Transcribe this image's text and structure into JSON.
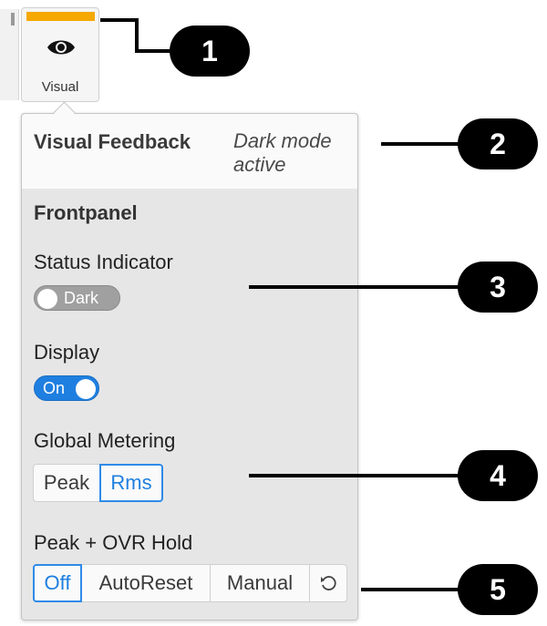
{
  "tabs": {
    "visual_label": "Visual",
    "accent_color": "#f5a800",
    "icon": "eye-icon"
  },
  "popover": {
    "title": "Visual Feedback",
    "subtitle": "Dark mode active",
    "section": "Frontpanel",
    "status_indicator": {
      "label": "Status Indicator",
      "toggle_label": "Dark",
      "state": "off"
    },
    "display": {
      "label": "Display",
      "toggle_label": "On",
      "state": "on"
    },
    "global_metering": {
      "label": "Global Metering",
      "options": [
        "Peak",
        "Rms"
      ],
      "selected": "Rms"
    },
    "peak_ovr_hold": {
      "label": "Peak + OVR Hold",
      "options": [
        "Off",
        "AutoReset",
        "Manual"
      ],
      "selected": "Off",
      "reset_icon": "reset-icon"
    }
  },
  "callouts": [
    "1",
    "2",
    "3",
    "4",
    "5"
  ],
  "colors": {
    "active_blue": "#1f7fe0",
    "panel_bg": "#e6e6e6",
    "callout": "#000000"
  }
}
